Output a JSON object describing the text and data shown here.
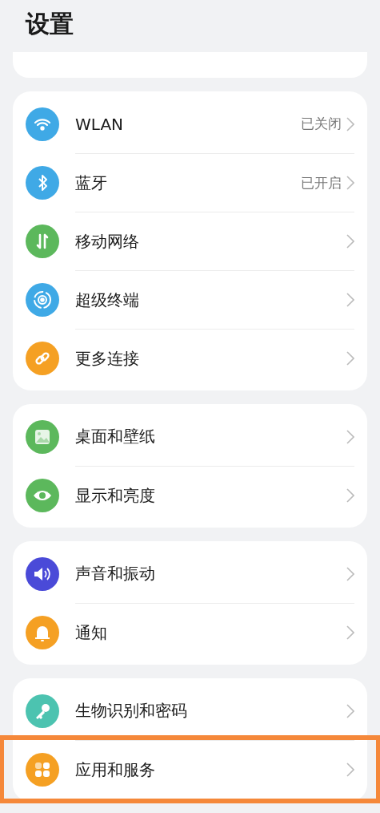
{
  "title": "设置",
  "groups": [
    {
      "items": [
        {
          "label": "WLAN",
          "status": "已关闭",
          "highlighted": false
        },
        {
          "label": "蓝牙",
          "status": "已开启",
          "highlighted": false
        },
        {
          "label": "移动网络",
          "highlighted": false
        },
        {
          "label": "超级终端",
          "highlighted": false
        },
        {
          "label": "更多连接",
          "highlighted": false
        }
      ]
    },
    {
      "items": [
        {
          "label": "桌面和壁纸",
          "highlighted": false
        },
        {
          "label": "显示和亮度",
          "highlighted": false
        }
      ]
    },
    {
      "items": [
        {
          "label": "声音和振动",
          "highlighted": false
        },
        {
          "label": "通知",
          "highlighted": false
        }
      ]
    },
    {
      "items": [
        {
          "label": "生物识别和密码",
          "highlighted": false
        },
        {
          "label": "应用和服务",
          "highlighted": true
        }
      ]
    }
  ]
}
